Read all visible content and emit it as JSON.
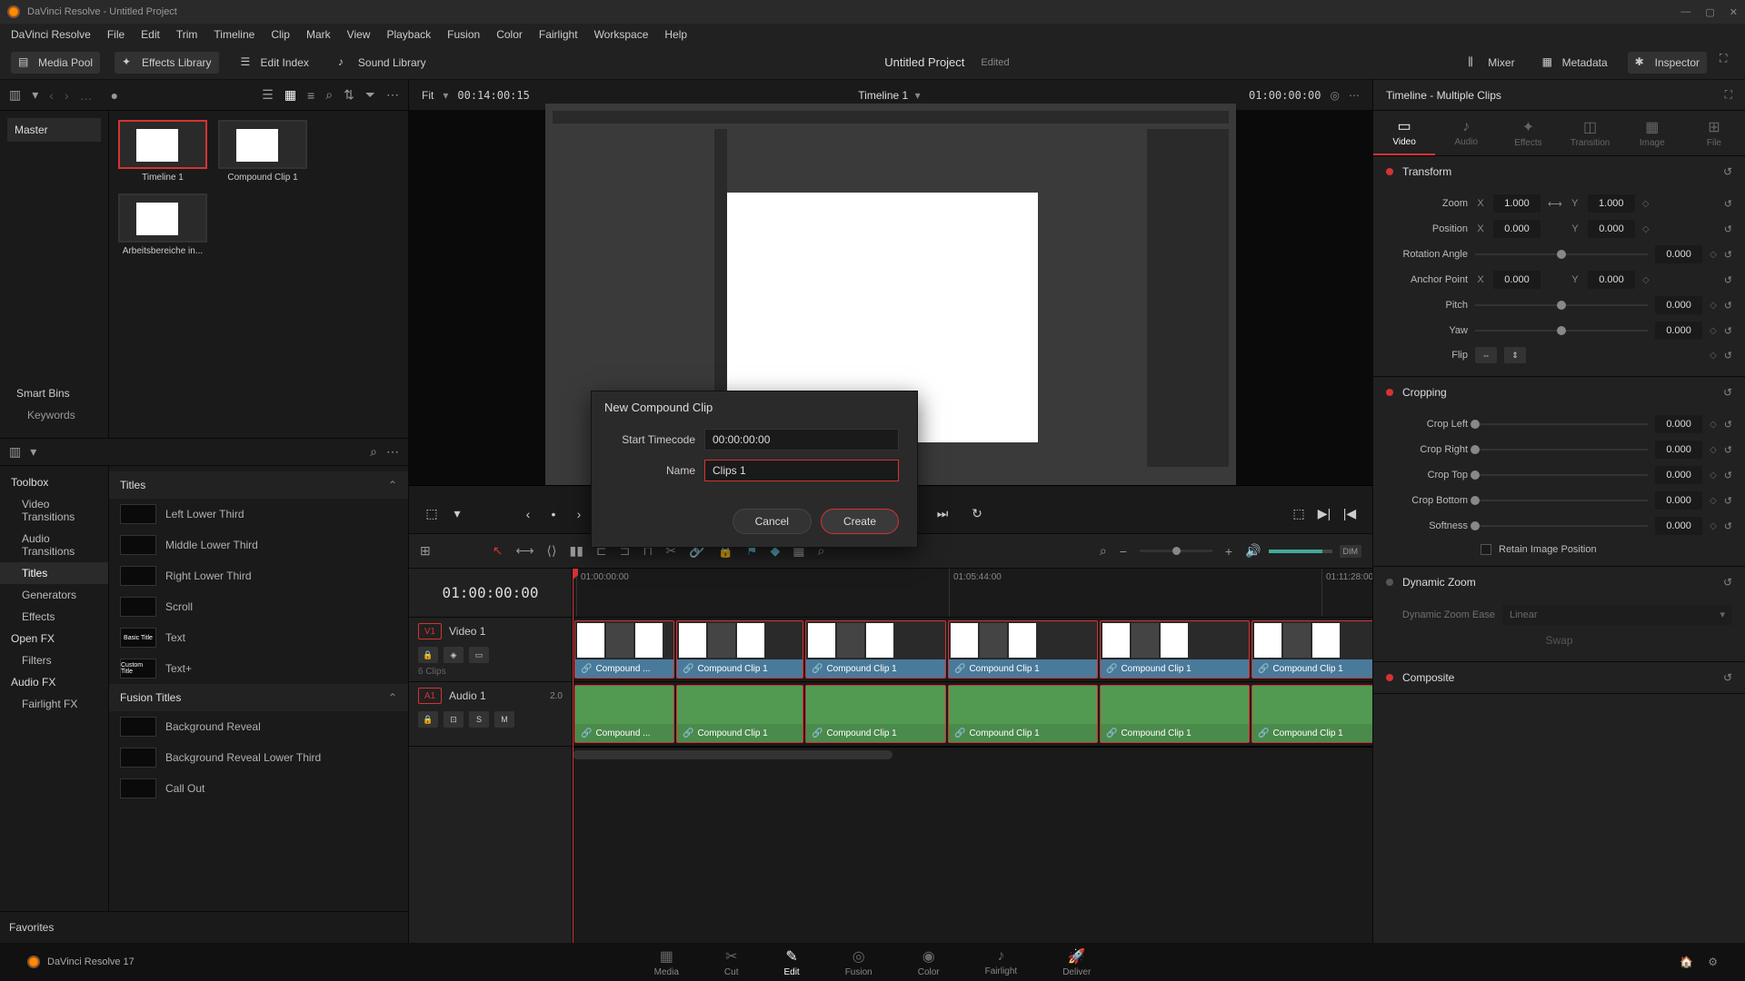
{
  "titlebar": {
    "title": "DaVinci Resolve - Untitled Project"
  },
  "menubar": [
    "DaVinci Resolve",
    "File",
    "Edit",
    "Trim",
    "Timeline",
    "Clip",
    "Mark",
    "View",
    "Playback",
    "Fusion",
    "Color",
    "Fairlight",
    "Workspace",
    "Help"
  ],
  "toolbar": {
    "mediaPool": "Media Pool",
    "effectsLibrary": "Effects Library",
    "editIndex": "Edit Index",
    "soundLibrary": "Sound Library",
    "projectTitle": "Untitled Project",
    "projectEdited": "Edited",
    "mixer": "Mixer",
    "metadata": "Metadata",
    "inspector": "Inspector"
  },
  "viewer": {
    "fit": "Fit",
    "leftTC": "00:14:00:15",
    "centerTitle": "Timeline 1",
    "rightTC": "01:00:00:00"
  },
  "mediaPool": {
    "master": "Master",
    "smartBins": "Smart Bins",
    "keywords": "Keywords",
    "items": [
      {
        "label": "Timeline 1",
        "active": true
      },
      {
        "label": "Compound Clip 1",
        "active": false
      },
      {
        "label": "Arbeitsbereiche in...",
        "active": false
      }
    ]
  },
  "effects": {
    "favorites": "Favorites",
    "tree": [
      {
        "label": "Toolbox",
        "head": true
      },
      {
        "label": "Video Transitions"
      },
      {
        "label": "Audio Transitions"
      },
      {
        "label": "Titles",
        "active": true
      },
      {
        "label": "Generators"
      },
      {
        "label": "Effects"
      },
      {
        "label": "Open FX",
        "head": true
      },
      {
        "label": "Filters"
      },
      {
        "label": "Audio FX",
        "head": true
      },
      {
        "label": "Fairlight FX"
      }
    ],
    "titlesHead": "Titles",
    "fusionHead": "Fusion Titles",
    "presets": [
      "Left Lower Third",
      "Middle Lower Third",
      "Right Lower Third",
      "Scroll",
      "Text",
      "Text+"
    ],
    "fusionPresets": [
      "Background Reveal",
      "Background Reveal Lower Third",
      "Call Out"
    ]
  },
  "dialog": {
    "title": "New Compound Clip",
    "startLabel": "Start Timecode",
    "startValue": "00:00:00:00",
    "nameLabel": "Name",
    "nameValue": "Clips 1",
    "cancel": "Cancel",
    "create": "Create"
  },
  "inspector": {
    "header": "Timeline - Multiple Clips",
    "tabs": [
      "Video",
      "Audio",
      "Effects",
      "Transition",
      "Image",
      "File"
    ],
    "activeTab": 0,
    "transform": {
      "title": "Transform",
      "zoom": "Zoom",
      "zoomX": "1.000",
      "zoomY": "1.000",
      "position": "Position",
      "posX": "0.000",
      "posY": "0.000",
      "rotation": "Rotation Angle",
      "rotVal": "0.000",
      "anchor": "Anchor Point",
      "anchX": "0.000",
      "anchY": "0.000",
      "pitch": "Pitch",
      "pitchVal": "0.000",
      "yaw": "Yaw",
      "yawVal": "0.000",
      "flip": "Flip"
    },
    "cropping": {
      "title": "Cropping",
      "left": "Crop Left",
      "leftVal": "0.000",
      "right": "Crop Right",
      "rightVal": "0.000",
      "top": "Crop Top",
      "topVal": "0.000",
      "bottom": "Crop Bottom",
      "bottomVal": "0.000",
      "softness": "Softness",
      "softVal": "0.000",
      "retain": "Retain Image Position"
    },
    "dynamicZoom": {
      "title": "Dynamic Zoom",
      "ease": "Dynamic Zoom Ease",
      "easeVal": "Linear",
      "swap": "Swap"
    },
    "composite": {
      "title": "Composite"
    }
  },
  "timeline": {
    "tc": "01:00:00:00",
    "tracks": {
      "v1": {
        "badge": "V1",
        "name": "Video 1",
        "clips": "6 Clips"
      },
      "a1": {
        "badge": "A1",
        "name": "Audio 1",
        "ch": "2.0"
      }
    },
    "ruler": [
      {
        "pos": 0,
        "label": "01:00:00:00"
      },
      {
        "pos": 410,
        "label": "01:05:44:00"
      },
      {
        "pos": 820,
        "label": "01:11:28:00"
      }
    ],
    "clipLabel": "Compound Clip 1",
    "clipLabelShort": "Compound ..."
  },
  "pageTabs": [
    "Media",
    "Cut",
    "Edit",
    "Fusion",
    "Color",
    "Fairlight",
    "Deliver"
  ],
  "activePageTab": 2,
  "appLabel": "DaVinci Resolve 17"
}
